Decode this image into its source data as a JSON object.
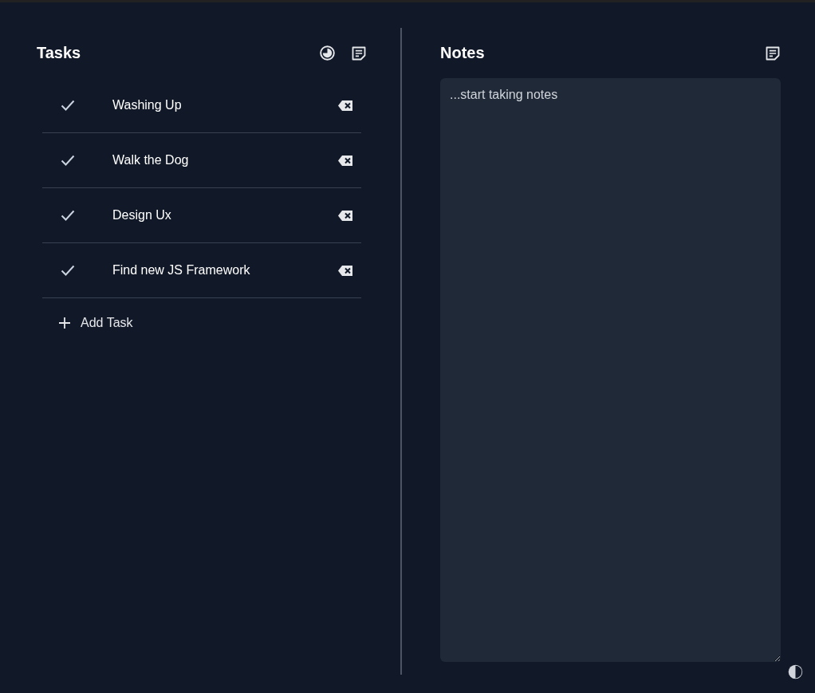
{
  "tasks_panel": {
    "title": "Tasks",
    "tasks": [
      {
        "label": "Washing Up",
        "done": true
      },
      {
        "label": "Walk the Dog",
        "done": true
      },
      {
        "label": "Design Ux",
        "done": true
      },
      {
        "label": "Find new JS Framework",
        "done": true
      }
    ],
    "add_button": "Add Task"
  },
  "notes_panel": {
    "title": "Notes",
    "placeholder": "...start taking notes"
  }
}
